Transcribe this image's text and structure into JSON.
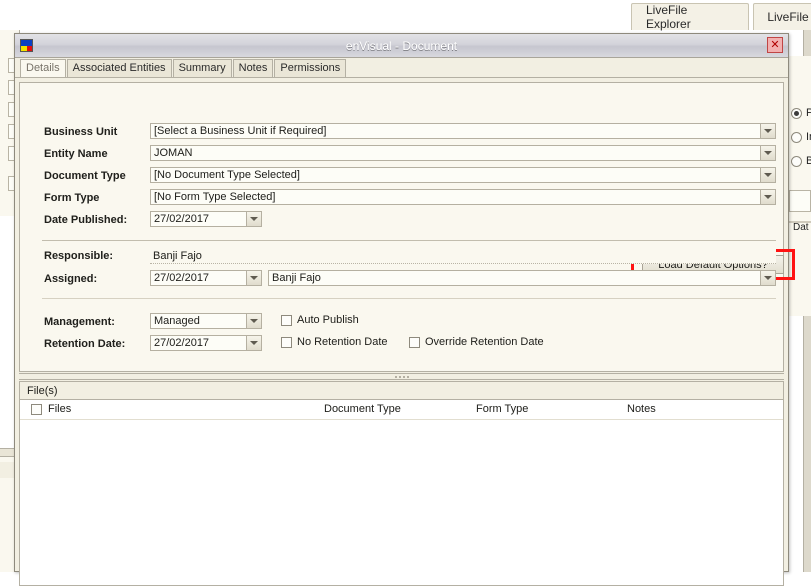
{
  "background": {
    "tabs": [
      {
        "label": "LiveFile Explorer"
      },
      {
        "label": "LiveFile"
      }
    ],
    "right_panel": {
      "radios": [
        {
          "label": "P",
          "selected": true
        },
        {
          "label": "In",
          "selected": false
        },
        {
          "label": "B",
          "selected": false
        }
      ],
      "date_label": "Dat"
    }
  },
  "dialog": {
    "title": "enVisual - Document",
    "icon": "app-logo-icon",
    "close_label": "✕",
    "tabs": [
      {
        "label": "Details",
        "active": true
      },
      {
        "label": "Associated Entities",
        "active": false
      },
      {
        "label": "Summary",
        "active": false
      },
      {
        "label": "Notes",
        "active": false
      },
      {
        "label": "Permissions",
        "active": false
      }
    ],
    "form": {
      "business_unit": {
        "label": "Business Unit",
        "value": "[Select a Business Unit if Required]"
      },
      "entity_name": {
        "label": "Entity Name",
        "value": "JOMAN"
      },
      "document_type": {
        "label": "Document Type",
        "value": "[No Document Type Selected]"
      },
      "form_type": {
        "label": "Form Type",
        "value": "[No Form Type Selected]"
      },
      "date_published": {
        "label": "Date Published:",
        "value": "27/02/2017"
      },
      "responsible": {
        "label": "Responsible:",
        "value": "Banji Fajo"
      },
      "assigned": {
        "label": "Assigned:",
        "date_value": "27/02/2017",
        "name_value": "Banji Fajo"
      },
      "management": {
        "label": "Management:",
        "value": "Managed"
      },
      "retention_date": {
        "label": "Retention Date:",
        "value": "27/02/2017"
      },
      "checkboxes": [
        {
          "label": "Auto Publish",
          "checked": false
        },
        {
          "label": "No Retention Date",
          "checked": false
        },
        {
          "label": "Override Retention Date",
          "checked": false
        }
      ],
      "load_defaults_button": "Load Default Options?"
    },
    "files": {
      "section_title": "File(s)",
      "columns": [
        "Files",
        "Document Type",
        "Form Type",
        "Notes"
      ],
      "rows": []
    }
  },
  "colors": {
    "highlight_red": "#ff1212",
    "dialog_bg": "#f2efe2",
    "field_bg": "#fdfdf7",
    "title_gradient_top": "#e2e2e6"
  }
}
